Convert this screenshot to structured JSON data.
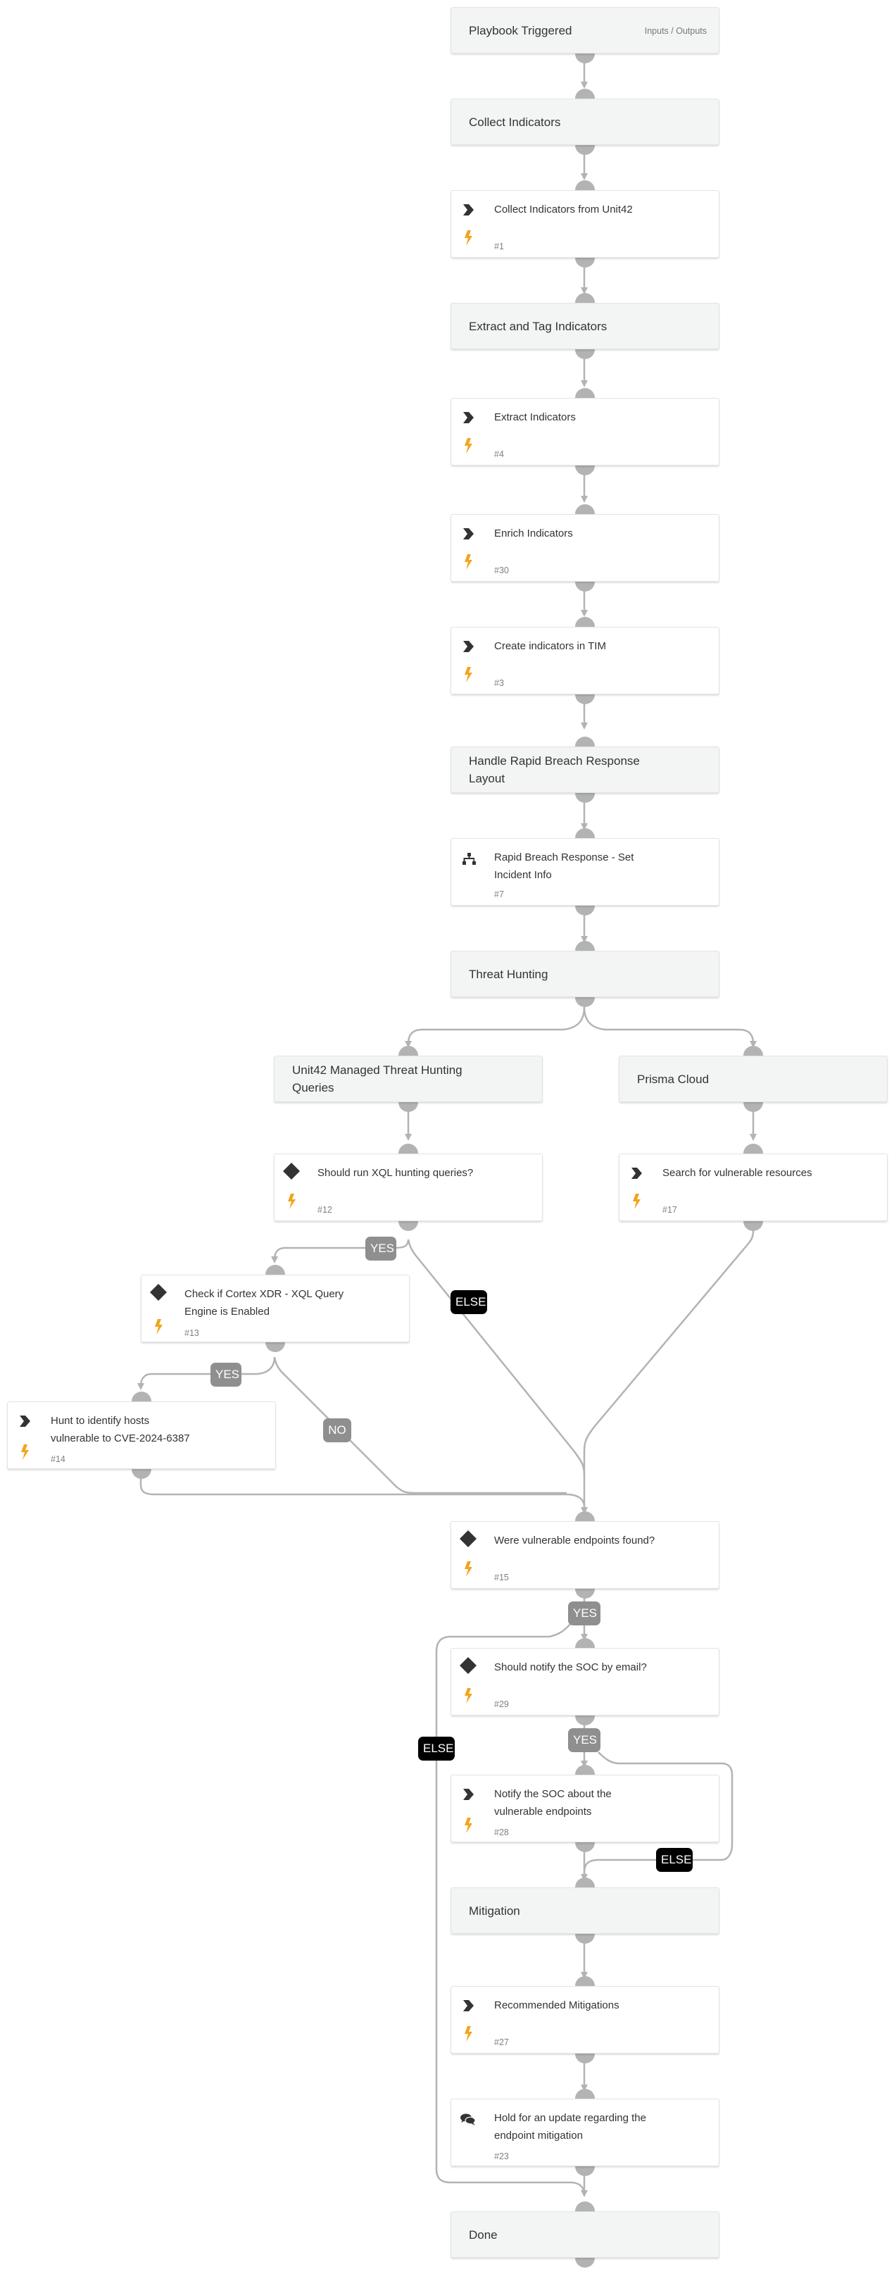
{
  "diagram": {
    "colors": {
      "connector": "#b3b3b3",
      "section_bg": "#f3f4f4",
      "task_bg": "#ffffff",
      "bolt": "#f0a51e",
      "icon": "#333333",
      "yes_label": "#8f8f8f",
      "else_label": "#000000"
    },
    "start": {
      "title": "Playbook Triggered",
      "io_link": "Inputs / Outputs"
    },
    "sections": {
      "collect": "Collect Indicators",
      "extract_tag": "Extract and Tag Indicators",
      "layout": "Handle Rapid Breach Response Layout",
      "threat_hunting": "Threat Hunting",
      "unit42": "Unit42 Managed Threat Hunting Queries",
      "prisma": "Prisma Cloud",
      "mitigation": "Mitigation",
      "done": "Done"
    },
    "tasks": {
      "t1": {
        "title": "Collect Indicators from Unit42",
        "id": "#1",
        "icon": "playbook-chevron-icon"
      },
      "t4": {
        "title": "Extract Indicators",
        "id": "#4",
        "icon": "playbook-chevron-icon"
      },
      "t30": {
        "title": "Enrich Indicators",
        "id": "#30",
        "icon": "playbook-chevron-icon"
      },
      "t3": {
        "title": "Create indicators in TIM",
        "id": "#3",
        "icon": "playbook-chevron-icon"
      },
      "t7": {
        "title": "Rapid Breach Response - Set Incident Info",
        "id": "#7",
        "icon": "sitemap-icon"
      },
      "t12": {
        "title": "Should run XQL hunting queries?",
        "id": "#12",
        "icon": "condition-diamond-icon"
      },
      "t17": {
        "title": "Search for vulnerable resources",
        "id": "#17",
        "icon": "playbook-chevron-icon"
      },
      "t13": {
        "title": "Check if Cortex XDR - XQL Query Engine is Enabled",
        "id": "#13",
        "icon": "condition-diamond-icon"
      },
      "t14": {
        "title": "Hunt to identify hosts vulnerable to CVE-2024-6387",
        "id": "#14",
        "icon": "playbook-chevron-icon"
      },
      "t15": {
        "title": "Were vulnerable endpoints found?",
        "id": "#15",
        "icon": "condition-diamond-icon"
      },
      "t29": {
        "title": "Should notify the SOC by email?",
        "id": "#29",
        "icon": "condition-diamond-icon"
      },
      "t28": {
        "title": "Notify the SOC about the vulnerable endpoints",
        "id": "#28",
        "icon": "playbook-chevron-icon"
      },
      "t27": {
        "title": "Recommended Mitigations",
        "id": "#27",
        "icon": "playbook-chevron-icon"
      },
      "t23": {
        "title": "Hold for an update regarding the endpoint mitigation",
        "id": "#23",
        "icon": "chat-bubbles-icon"
      }
    },
    "labels": {
      "yes_12": "YES",
      "else_12": "ELSE",
      "yes_13": "YES",
      "no_13": "NO",
      "yes_15": "YES",
      "else_15": "ELSE",
      "yes_29": "YES",
      "else_29": "ELSE"
    }
  }
}
